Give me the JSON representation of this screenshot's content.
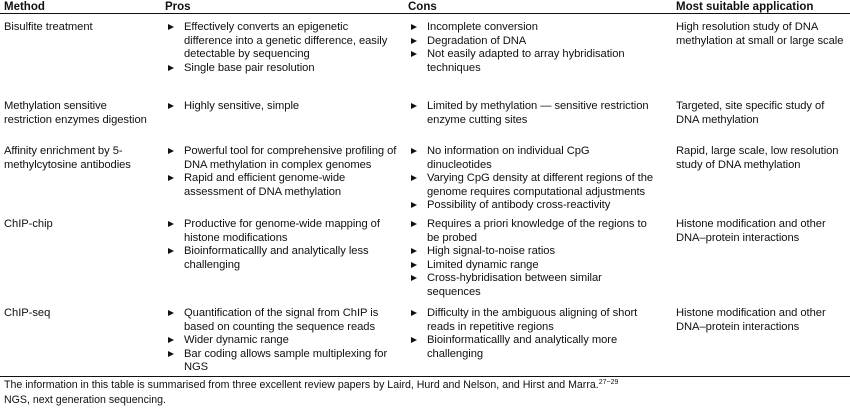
{
  "headers": {
    "method": "Method",
    "pros": "Pros",
    "cons": "Cons",
    "application": "Most suitable application"
  },
  "rows": [
    {
      "method": "Bisulfite treatment",
      "pros": [
        "Effectively converts an epigenetic difference into a genetic difference, easily detectable by sequencing",
        "Single base pair resolution"
      ],
      "cons": [
        "Incomplete conversion",
        "Degradation of DNA",
        "Not easily adapted to array hybridisation techniques"
      ],
      "application": "High resolution study of DNA methylation at small or large scale"
    },
    {
      "method": "Methylation sensitive restriction enzymes digestion",
      "pros": [
        "Highly sensitive, simple"
      ],
      "cons": [
        "Limited by methylation — sensitive restriction enzyme cutting sites"
      ],
      "application": "Targeted, site specific study of DNA methylation"
    },
    {
      "method": "Affinity enrichment by 5-methylcytosine antibodies",
      "pros": [
        "Powerful tool for comprehensive profiling of DNA methylation in complex genomes",
        "Rapid and efficient genome-wide assessment of DNA methylation"
      ],
      "cons": [
        "No information on individual CpG dinucleotides",
        "Varying CpG density at different regions of the genome requires computational adjustments",
        "Possibility of antibody cross-reactivity"
      ],
      "application": "Rapid, large scale, low resolution study of DNA methylation"
    },
    {
      "method": "ChIP-chip",
      "pros": [
        "Productive for genome-wide mapping of histone modifications",
        "Bioinformaticallly and analytically less challenging"
      ],
      "cons": [
        "Requires a priori knowledge of the regions to be probed",
        "High signal-to-noise ratios",
        "Limited dynamic range",
        "Cross-hybridisation between similar sequences"
      ],
      "application": "Histone modification and other DNA–protein interactions"
    },
    {
      "method": "ChIP-seq",
      "pros": [
        "Quantification of the signal from ChIP is based on counting the sequence reads",
        "Wider dynamic range",
        "Bar coding allows sample multiplexing for NGS"
      ],
      "cons": [
        "Difficulty in the ambiguous aligning of short reads in repetitive regions",
        "Bioinformaticallly and analytically more challenging"
      ],
      "application": "Histone modification and other DNA–protein interactions"
    }
  ],
  "footnotes": {
    "note1": "The information in this table is summarised from three excellent review papers by Laird, Hurd and Nelson, and Hirst and Marra.",
    "note1_refs": "27−29",
    "note2": "NGS, next generation sequencing."
  }
}
